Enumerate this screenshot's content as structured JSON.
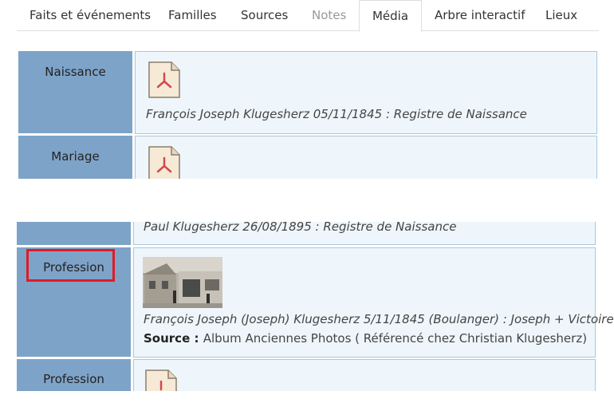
{
  "tabs": [
    {
      "label": "Faits et événements"
    },
    {
      "label": "Familles"
    },
    {
      "label": "Sources"
    },
    {
      "label": "Notes"
    },
    {
      "label": "Média"
    },
    {
      "label": "Arbre interactif"
    },
    {
      "label": "Lieux"
    }
  ],
  "rows": {
    "naissance": {
      "label": "Naissance",
      "caption": "François Joseph Klugesherz 05/11/1845 : Registre de Naissance"
    },
    "mariage": {
      "label": "Mariage"
    },
    "naissance_paul": {
      "caption": "Paul Klugesherz 26/08/1895 : Registre de Naissance"
    },
    "profession": {
      "label": "Profession",
      "caption": "François Joseph (Joseph) Klugesherz 5/11/1845 (Boulanger) : Joseph + Victoire",
      "source_label": "Source",
      "source_sep": " : ",
      "source_text": "Album Anciennes Photos ( Référencé chez Christian Klugesherz)"
    },
    "profession2": {
      "label": "Profession"
    }
  },
  "icons": {
    "pdf": "pdf-file-icon",
    "photo": "photo-thumbnail"
  },
  "colors": {
    "label_bg": "#7ea3c8",
    "content_bg": "#eef6fb",
    "highlight": "#e01b24"
  }
}
